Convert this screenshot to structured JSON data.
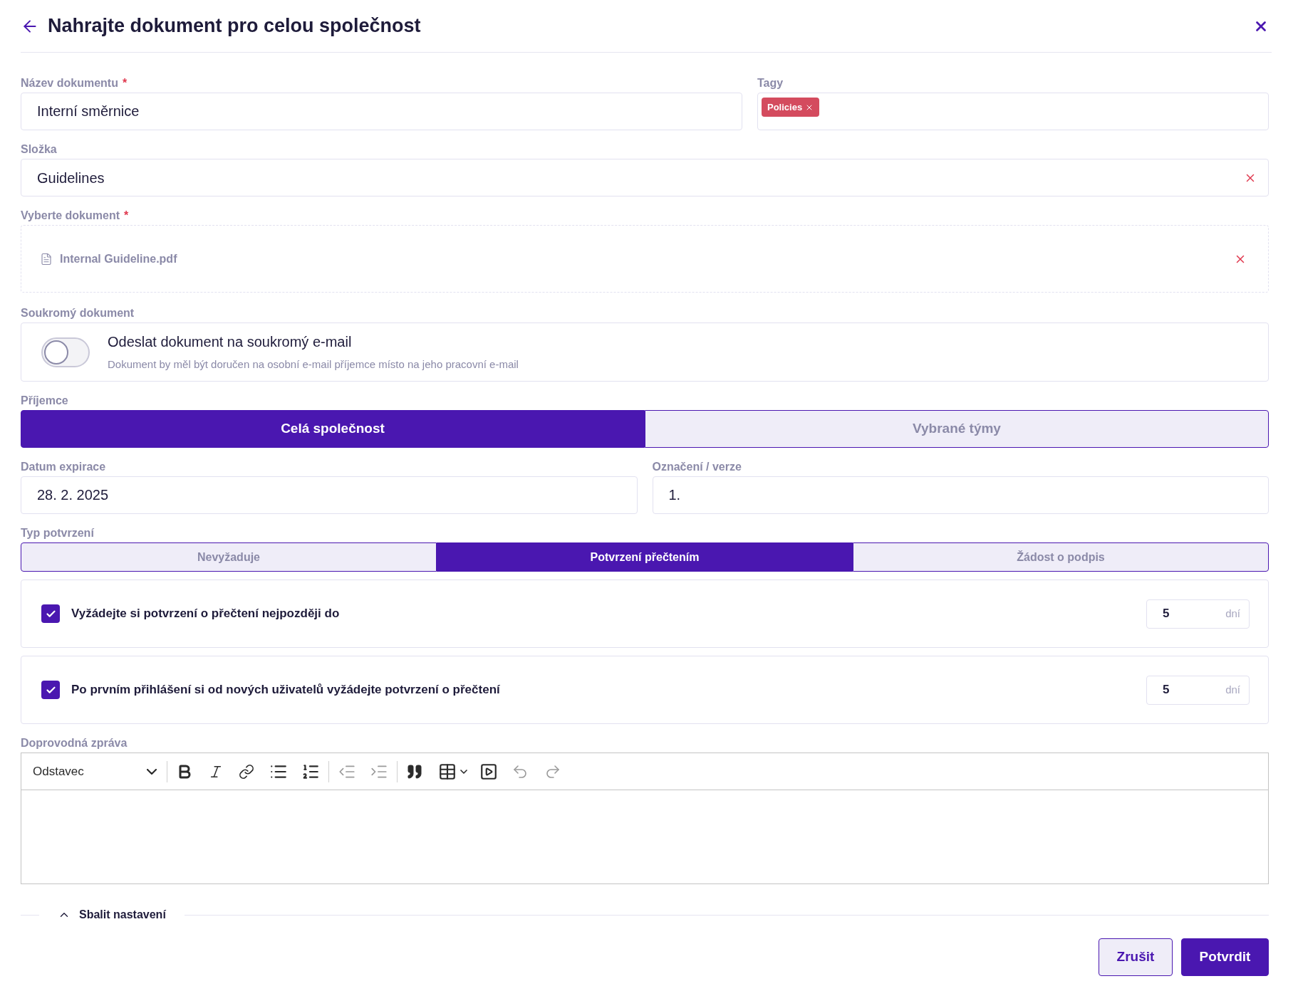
{
  "header": {
    "title": "Nahrajte dokument pro celou společnost"
  },
  "document_name": {
    "label": "Název dokumentu",
    "required_mark": "*",
    "value": "Interní směrnice"
  },
  "tags": {
    "label": "Tagy",
    "items": [
      {
        "label": "Policies"
      }
    ]
  },
  "folder": {
    "label": "Složka",
    "value": "Guidelines"
  },
  "file_select": {
    "label": "Vyberte dokument",
    "required_mark": "*",
    "file_name": "Internal Guideline.pdf"
  },
  "private_document": {
    "label": "Soukromý dokument",
    "on": false,
    "title": "Odeslat dokument na soukromý e-mail",
    "description": "Dokument by měl být doručen na osobní e-mail příjemce místo na jeho pracovní e-mail"
  },
  "recipients": {
    "label": "Příjemce",
    "options": [
      {
        "label": "Celá společnost",
        "selected": true
      },
      {
        "label": "Vybrané týmy",
        "selected": false
      }
    ]
  },
  "expiration": {
    "label": "Datum expirace",
    "value": "28. 2. 2025"
  },
  "version": {
    "label": "Označení / verze",
    "value": "1."
  },
  "confirmation_type": {
    "label": "Typ potvrzení",
    "options": [
      {
        "label": "Nevyžaduje",
        "selected": false
      },
      {
        "label": "Potvrzení přečtením",
        "selected": true
      },
      {
        "label": "Žádost o podpis",
        "selected": false
      }
    ]
  },
  "requirements": [
    {
      "label": "Vyžádejte si potvrzení o přečtení nejpozději do",
      "checked": true,
      "days": "5",
      "unit": "dní"
    },
    {
      "label": "Po prvním přihlášení si od nových uživatelů vyžádejte potvrzení o přečtení",
      "checked": true,
      "days": "5",
      "unit": "dní"
    }
  ],
  "message": {
    "label": "Doprovodná zpráva",
    "block_format": "Odstavec"
  },
  "collapse": {
    "label": "Sbalit nastavení"
  },
  "buttons": [
    {
      "label": "Zrušit",
      "kind": "secondary"
    },
    {
      "label": "Potvrdit",
      "kind": "primary"
    }
  ]
}
